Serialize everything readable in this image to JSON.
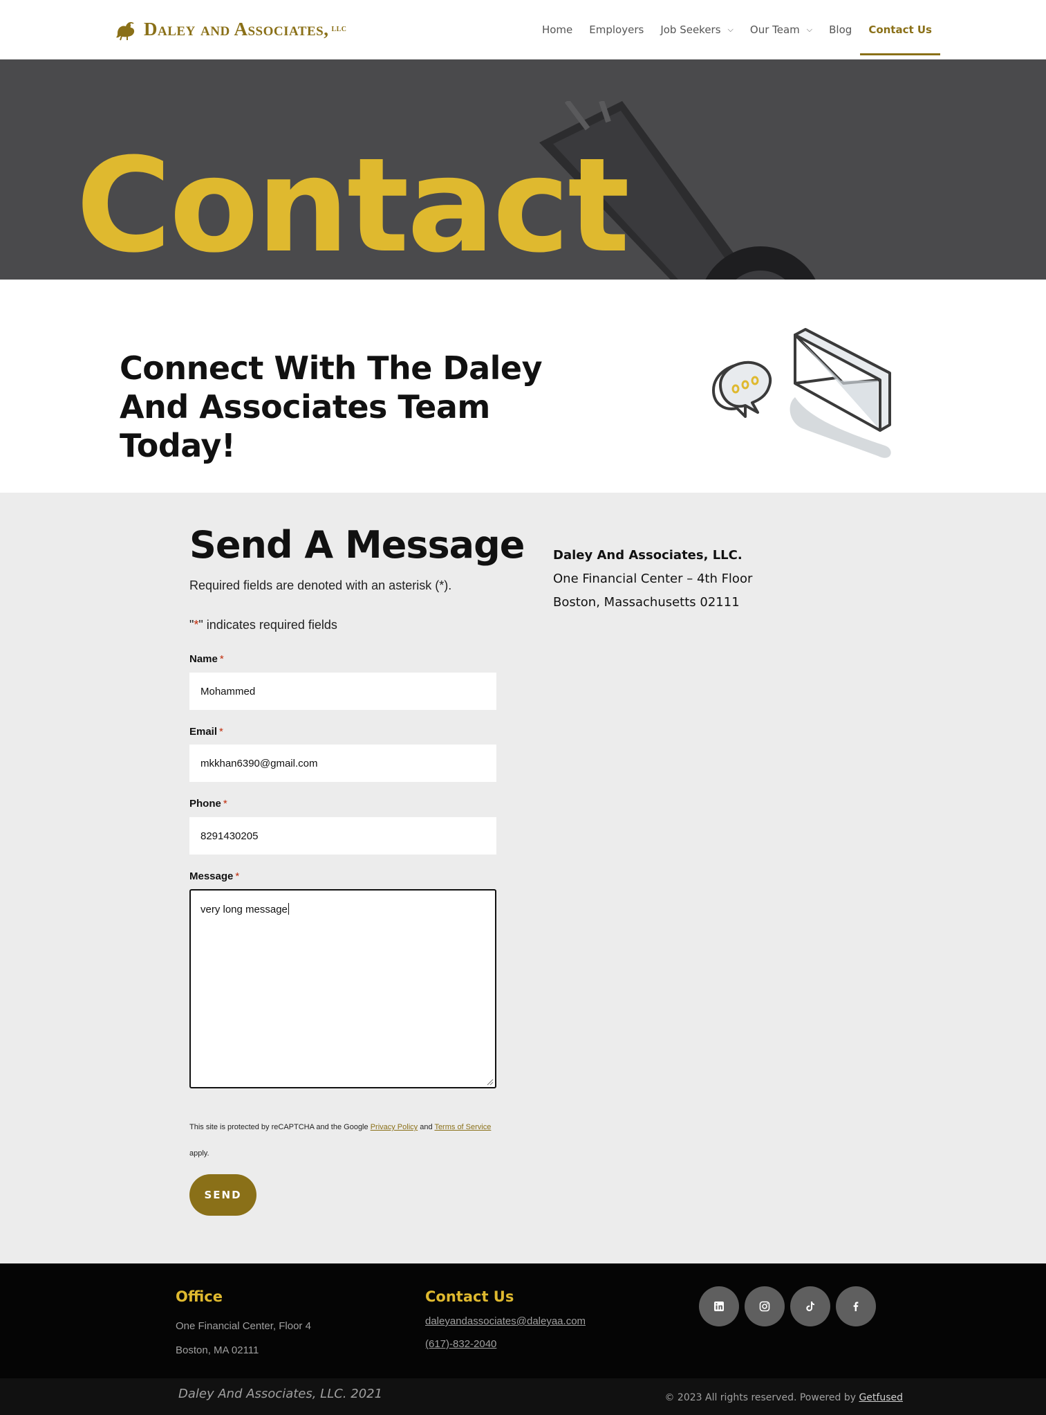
{
  "header": {
    "logo_text": "Daley and Associates,",
    "logo_suffix": "llc",
    "nav": [
      {
        "label": "Home",
        "has_dropdown": false,
        "active": false
      },
      {
        "label": "Employers",
        "has_dropdown": false,
        "active": false
      },
      {
        "label": "Job Seekers",
        "has_dropdown": true,
        "active": false
      },
      {
        "label": "Our Team",
        "has_dropdown": true,
        "active": false
      },
      {
        "label": "Blog",
        "has_dropdown": false,
        "active": false
      },
      {
        "label": "Contact Us",
        "has_dropdown": false,
        "active": true
      }
    ]
  },
  "hero": {
    "title": "Contact"
  },
  "connect": {
    "heading": "Connect With The Daley And Associates Team Today!"
  },
  "form": {
    "title": "Send A Message",
    "required_note": "Required fields are denoted with an asterisk (*).",
    "indicator_quote_open": "\"",
    "indicator_asterisk": "*",
    "indicator_rest": "\" indicates required fields",
    "fields": {
      "name": {
        "label": "Name",
        "value": "Mohammed"
      },
      "email": {
        "label": "Email",
        "value": "mkkhan6390@gmail.com"
      },
      "phone": {
        "label": "Phone",
        "value": "8291430205"
      },
      "message": {
        "label": "Message",
        "value": "very long message"
      }
    },
    "required_mark": "*",
    "recaptcha": {
      "prefix": "This site is protected by reCAPTCHA and the Google ",
      "privacy_link": "Privacy Policy",
      "and": " and ",
      "terms_link": "Terms of Service",
      "suffix": " apply."
    },
    "send_label": "SEND"
  },
  "address": {
    "company": "Daley And Associates, LLC.",
    "line1": "One Financial Center – 4th Floor",
    "line2": "Boston, Massachusetts 02111"
  },
  "footer": {
    "office_heading": "Office",
    "office_line1": "One Financial Center, Floor 4",
    "office_line2": "Boston, MA 02111",
    "contact_heading": "Contact Us",
    "contact_email": "daleyandassociates@daleyaa.com",
    "contact_phone": "(617)-832-2040",
    "social": [
      "linkedin-icon",
      "instagram-icon",
      "tiktok-icon",
      "facebook-icon"
    ],
    "copyright_left": "Daley And Associates, LLC. 2021",
    "copyright_right": "© 2023 All rights reserved. Powered by ",
    "powered_link": "Getfused"
  },
  "colors": {
    "brand_gold": "#8a7018",
    "hero_gold": "#dfb92f",
    "required_red": "#c02b0a",
    "form_bg": "#ececec",
    "footer_bg": "#050505"
  }
}
